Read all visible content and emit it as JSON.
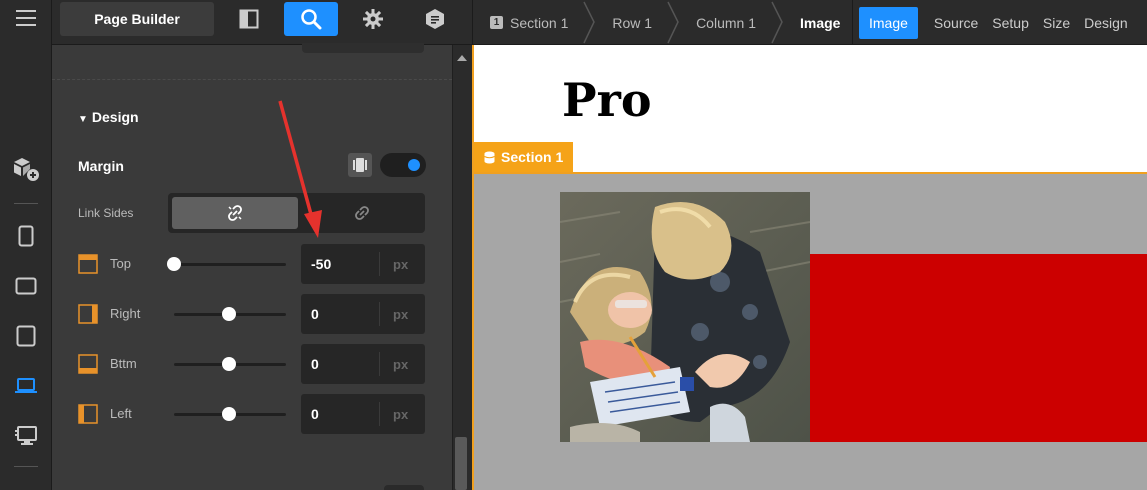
{
  "toolbar": {
    "page_builder_label": "Page Builder",
    "layout_icon": "panel-layout-icon",
    "search_icon": "search-icon",
    "settings_icon": "gear-icon",
    "addons_icon": "hexagon-icon"
  },
  "breadcrumb": {
    "section": "Section 1",
    "section_num": "1",
    "row": "Row 1",
    "column": "Column 1",
    "current": "Image"
  },
  "tabs": [
    "Image",
    "Source",
    "Setup",
    "Size",
    "Design"
  ],
  "rail_icons": [
    "hamburger-menu-icon",
    "modules-add-icon",
    "mobile-device-icon",
    "tablet-landscape-icon",
    "tablet-portrait-icon",
    "laptop-icon",
    "desktop-icon"
  ],
  "panel": {
    "design_heading": "Design",
    "margin_label": "Margin",
    "link_sides_label": "Link Sides",
    "rows": [
      {
        "label": "Top",
        "value": "-50",
        "unit": "px"
      },
      {
        "label": "Right",
        "value": "0",
        "unit": "px"
      },
      {
        "label": "Bttm",
        "value": "0",
        "unit": "px"
      },
      {
        "label": "Left",
        "value": "0",
        "unit": "px"
      }
    ],
    "margin_toggle_on": true
  },
  "canvas": {
    "heading": "Pro",
    "section_tag": "Section 1"
  },
  "colors": {
    "accent": "#1e90ff",
    "section_orange": "#f5a318",
    "side_icon_orange": "#e8922a",
    "red_block": "#cc0000",
    "section_gray": "#a6a6a6",
    "annotation_arrow": "#e5322d"
  }
}
